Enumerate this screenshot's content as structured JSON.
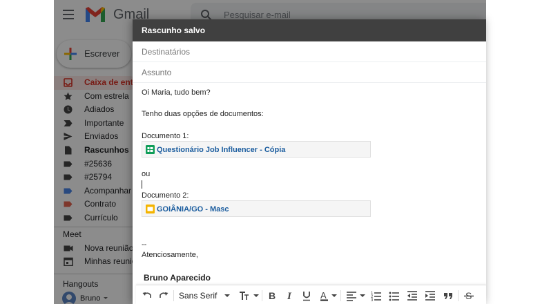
{
  "gmail": {
    "logo_text": "Gmail",
    "search_placeholder": "Pesquisar e-mail",
    "compose_label": "Escrever",
    "nav": [
      {
        "label": "Caixa de entrada",
        "icon": "inbox-icon",
        "active": true
      },
      {
        "label": "Com estrela",
        "icon": "star-icon"
      },
      {
        "label": "Adiados",
        "icon": "clock-icon"
      },
      {
        "label": "Importante",
        "icon": "important-icon"
      },
      {
        "label": "Enviados",
        "icon": "send-icon"
      },
      {
        "label": "Rascunhos",
        "icon": "draft-icon",
        "bold": true
      },
      {
        "label": "#25636",
        "icon": "label-icon"
      },
      {
        "label": "#25794",
        "icon": "label-icon"
      },
      {
        "label": "Acompanhar",
        "icon": "label-icon",
        "color": "#4a86e8"
      },
      {
        "label": "Contrato",
        "icon": "label-icon",
        "color": "#e66550"
      },
      {
        "label": "Currículo",
        "icon": "label-icon"
      }
    ],
    "meet": {
      "title": "Meet",
      "new_meeting": "Nova reunião",
      "my_meetings": "Minhas reuniões"
    },
    "hangouts": {
      "title": "Hangouts",
      "user": "Bruno"
    }
  },
  "compose": {
    "title": "Rascunho salvo",
    "to_placeholder": "Destinatários",
    "subject_placeholder": "Assunto",
    "body": {
      "greeting": "Oi Maria, tudo bem?",
      "intro": "Tenho duas opções de documentos:",
      "doc1_label": "Documento 1:",
      "doc1_chip": "Questionário Job Influencer - Cópia",
      "or": "ou",
      "doc2_label": "Documento 2:",
      "doc2_chip": "GOIÂNIA/GO - Masc",
      "sig_dashes": "--",
      "closing": "Atenciosamente,",
      "sig_name": "Bruno Aparecido"
    },
    "toolbar": {
      "font": "Sans Serif"
    }
  },
  "colors": {
    "compose_header": "#404040",
    "chip_link": "#1a5c9e",
    "sheets_green": "#0f9d58",
    "slides_yellow": "#f4b400",
    "active_red": "#d93025"
  }
}
